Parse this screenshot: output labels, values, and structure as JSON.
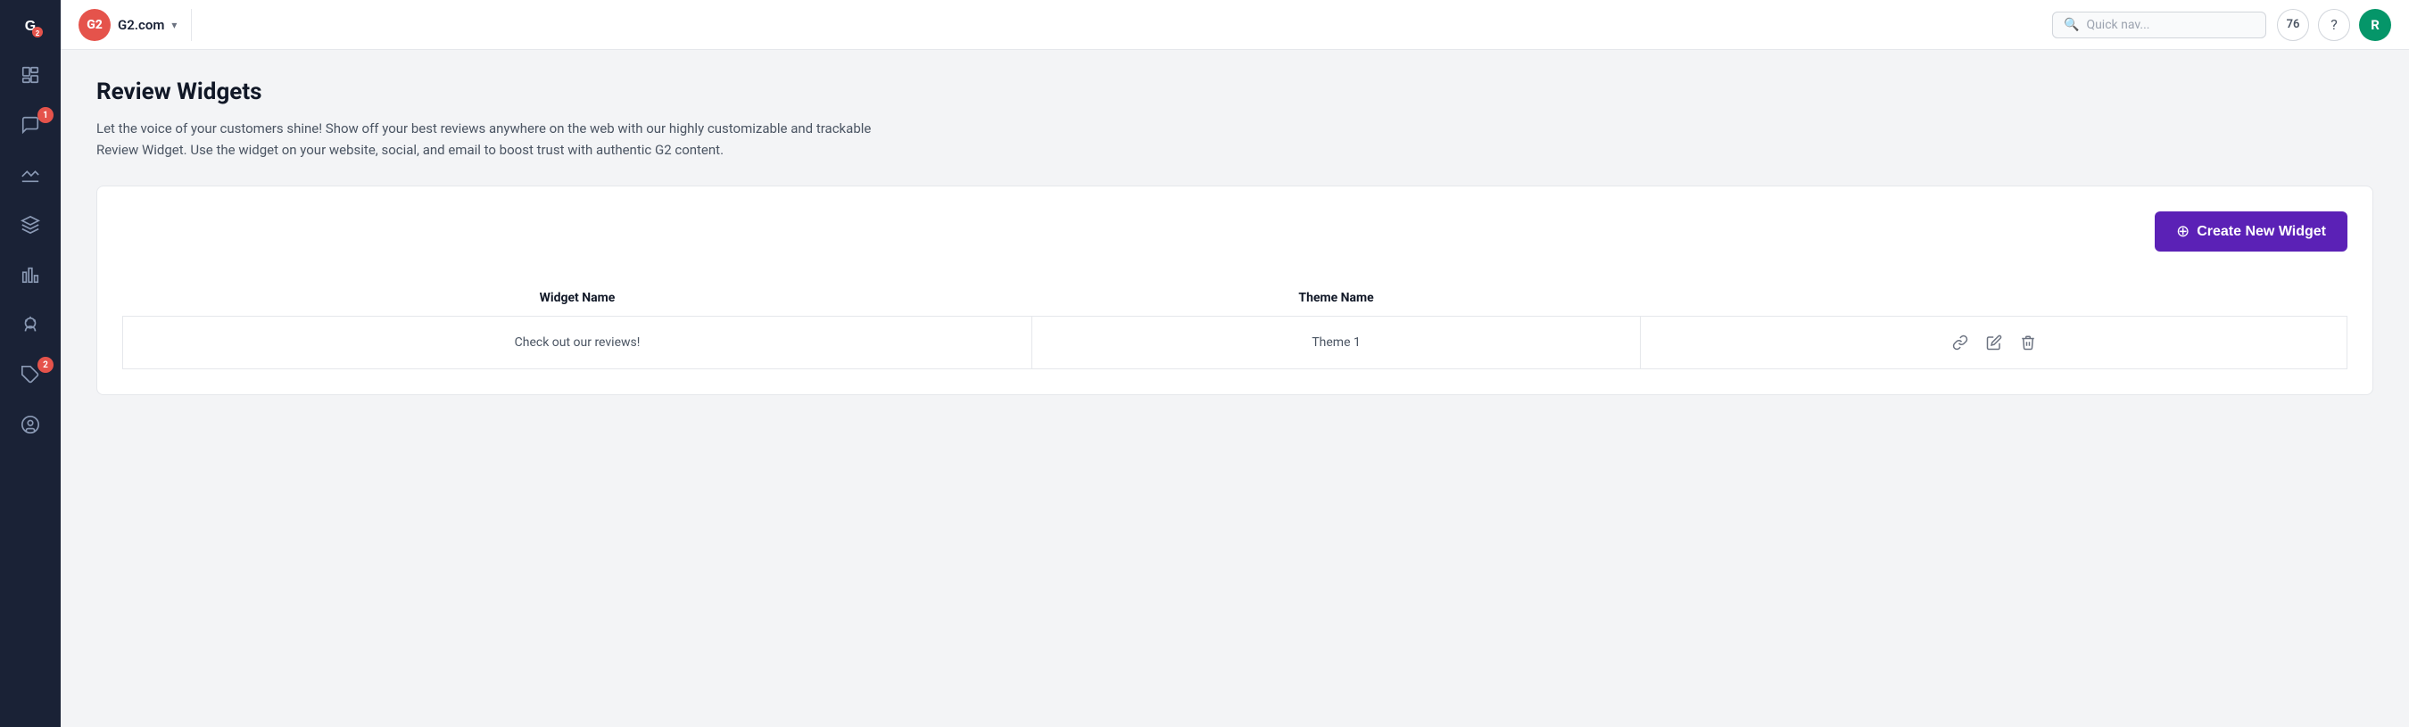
{
  "sidebar": {
    "icons": [
      {
        "name": "home-icon",
        "label": "Home"
      },
      {
        "name": "reports-icon",
        "label": "Reports"
      },
      {
        "name": "messages-icon",
        "label": "Messages",
        "badge": 1
      },
      {
        "name": "analytics-icon",
        "label": "Analytics"
      },
      {
        "name": "layers-icon",
        "label": "Layers"
      },
      {
        "name": "chart-icon",
        "label": "Chart"
      },
      {
        "name": "ai-icon",
        "label": "AI"
      },
      {
        "name": "integrations-icon",
        "label": "Integrations",
        "badge": 2
      },
      {
        "name": "profile-icon",
        "label": "Profile"
      }
    ]
  },
  "topbar": {
    "brand": {
      "logo_text": "G2",
      "name": "G2.com",
      "chevron": "▾"
    },
    "search": {
      "placeholder": "Quick nav..."
    },
    "notification_count": "76",
    "help_label": "?",
    "avatar_letter": "R"
  },
  "page": {
    "title": "Review Widgets",
    "description": "Let the voice of your customers shine! Show off your best reviews anywhere on the web with our highly customizable and trackable Review Widget. Use the widget on your website, social, and email to boost trust with authentic G2 content."
  },
  "widget_panel": {
    "create_button_label": "Create New Widget",
    "table": {
      "columns": [
        "Widget Name",
        "Theme Name"
      ],
      "rows": [
        {
          "widget_name": "Check out our reviews!",
          "theme_name": "Theme 1"
        }
      ]
    }
  }
}
